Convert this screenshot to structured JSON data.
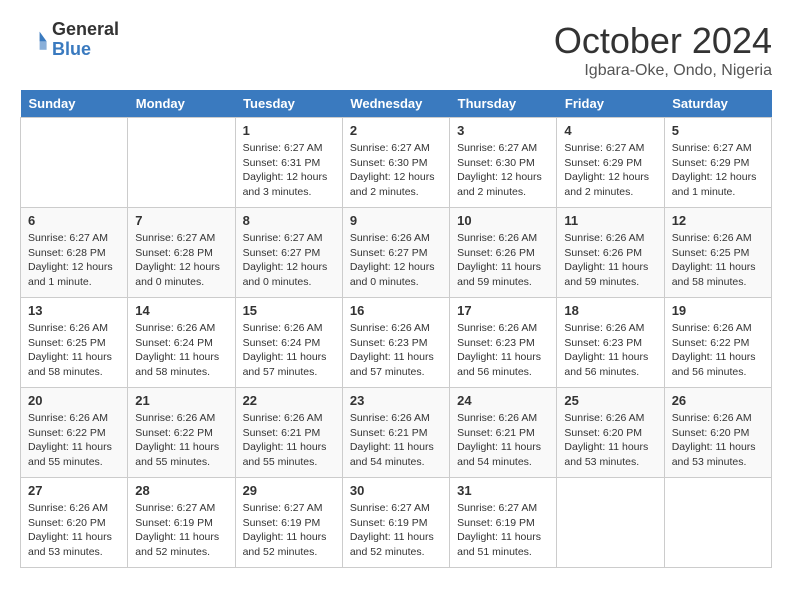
{
  "logo": {
    "text1": "General",
    "text2": "Blue"
  },
  "title": "October 2024",
  "location": "Igbara-Oke, Ondo, Nigeria",
  "weekdays": [
    "Sunday",
    "Monday",
    "Tuesday",
    "Wednesday",
    "Thursday",
    "Friday",
    "Saturday"
  ],
  "weeks": [
    [
      {
        "day": "",
        "info": ""
      },
      {
        "day": "",
        "info": ""
      },
      {
        "day": "1",
        "info": "Sunrise: 6:27 AM\nSunset: 6:31 PM\nDaylight: 12 hours and 3 minutes."
      },
      {
        "day": "2",
        "info": "Sunrise: 6:27 AM\nSunset: 6:30 PM\nDaylight: 12 hours and 2 minutes."
      },
      {
        "day": "3",
        "info": "Sunrise: 6:27 AM\nSunset: 6:30 PM\nDaylight: 12 hours and 2 minutes."
      },
      {
        "day": "4",
        "info": "Sunrise: 6:27 AM\nSunset: 6:29 PM\nDaylight: 12 hours and 2 minutes."
      },
      {
        "day": "5",
        "info": "Sunrise: 6:27 AM\nSunset: 6:29 PM\nDaylight: 12 hours and 1 minute."
      }
    ],
    [
      {
        "day": "6",
        "info": "Sunrise: 6:27 AM\nSunset: 6:28 PM\nDaylight: 12 hours and 1 minute."
      },
      {
        "day": "7",
        "info": "Sunrise: 6:27 AM\nSunset: 6:28 PM\nDaylight: 12 hours and 0 minutes."
      },
      {
        "day": "8",
        "info": "Sunrise: 6:27 AM\nSunset: 6:27 PM\nDaylight: 12 hours and 0 minutes."
      },
      {
        "day": "9",
        "info": "Sunrise: 6:26 AM\nSunset: 6:27 PM\nDaylight: 12 hours and 0 minutes."
      },
      {
        "day": "10",
        "info": "Sunrise: 6:26 AM\nSunset: 6:26 PM\nDaylight: 11 hours and 59 minutes."
      },
      {
        "day": "11",
        "info": "Sunrise: 6:26 AM\nSunset: 6:26 PM\nDaylight: 11 hours and 59 minutes."
      },
      {
        "day": "12",
        "info": "Sunrise: 6:26 AM\nSunset: 6:25 PM\nDaylight: 11 hours and 58 minutes."
      }
    ],
    [
      {
        "day": "13",
        "info": "Sunrise: 6:26 AM\nSunset: 6:25 PM\nDaylight: 11 hours and 58 minutes."
      },
      {
        "day": "14",
        "info": "Sunrise: 6:26 AM\nSunset: 6:24 PM\nDaylight: 11 hours and 58 minutes."
      },
      {
        "day": "15",
        "info": "Sunrise: 6:26 AM\nSunset: 6:24 PM\nDaylight: 11 hours and 57 minutes."
      },
      {
        "day": "16",
        "info": "Sunrise: 6:26 AM\nSunset: 6:23 PM\nDaylight: 11 hours and 57 minutes."
      },
      {
        "day": "17",
        "info": "Sunrise: 6:26 AM\nSunset: 6:23 PM\nDaylight: 11 hours and 56 minutes."
      },
      {
        "day": "18",
        "info": "Sunrise: 6:26 AM\nSunset: 6:23 PM\nDaylight: 11 hours and 56 minutes."
      },
      {
        "day": "19",
        "info": "Sunrise: 6:26 AM\nSunset: 6:22 PM\nDaylight: 11 hours and 56 minutes."
      }
    ],
    [
      {
        "day": "20",
        "info": "Sunrise: 6:26 AM\nSunset: 6:22 PM\nDaylight: 11 hours and 55 minutes."
      },
      {
        "day": "21",
        "info": "Sunrise: 6:26 AM\nSunset: 6:22 PM\nDaylight: 11 hours and 55 minutes."
      },
      {
        "day": "22",
        "info": "Sunrise: 6:26 AM\nSunset: 6:21 PM\nDaylight: 11 hours and 55 minutes."
      },
      {
        "day": "23",
        "info": "Sunrise: 6:26 AM\nSunset: 6:21 PM\nDaylight: 11 hours and 54 minutes."
      },
      {
        "day": "24",
        "info": "Sunrise: 6:26 AM\nSunset: 6:21 PM\nDaylight: 11 hours and 54 minutes."
      },
      {
        "day": "25",
        "info": "Sunrise: 6:26 AM\nSunset: 6:20 PM\nDaylight: 11 hours and 53 minutes."
      },
      {
        "day": "26",
        "info": "Sunrise: 6:26 AM\nSunset: 6:20 PM\nDaylight: 11 hours and 53 minutes."
      }
    ],
    [
      {
        "day": "27",
        "info": "Sunrise: 6:26 AM\nSunset: 6:20 PM\nDaylight: 11 hours and 53 minutes."
      },
      {
        "day": "28",
        "info": "Sunrise: 6:27 AM\nSunset: 6:19 PM\nDaylight: 11 hours and 52 minutes."
      },
      {
        "day": "29",
        "info": "Sunrise: 6:27 AM\nSunset: 6:19 PM\nDaylight: 11 hours and 52 minutes."
      },
      {
        "day": "30",
        "info": "Sunrise: 6:27 AM\nSunset: 6:19 PM\nDaylight: 11 hours and 52 minutes."
      },
      {
        "day": "31",
        "info": "Sunrise: 6:27 AM\nSunset: 6:19 PM\nDaylight: 11 hours and 51 minutes."
      },
      {
        "day": "",
        "info": ""
      },
      {
        "day": "",
        "info": ""
      }
    ]
  ]
}
